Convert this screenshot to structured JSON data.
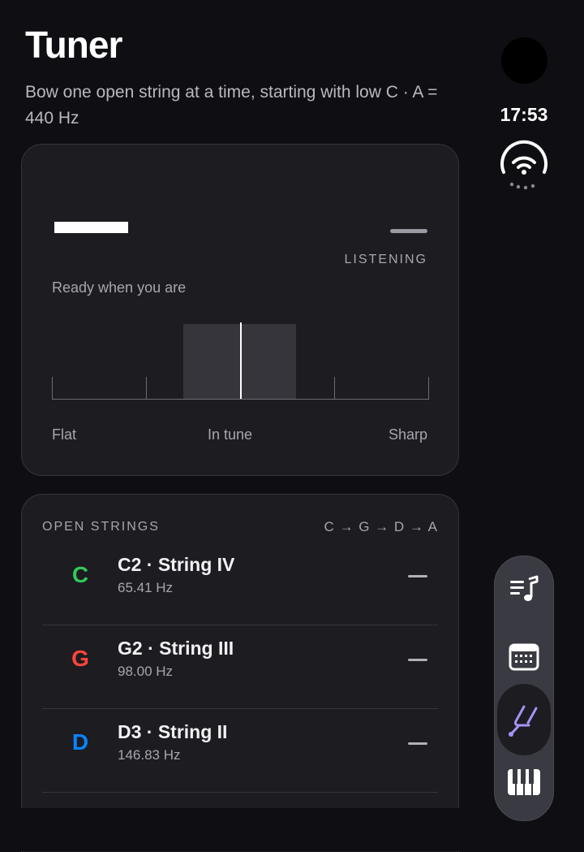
{
  "header": {
    "title": "Tuner",
    "subtitle": "Bow one open string at a time, starting with low C · A = 440 Hz"
  },
  "tuner": {
    "status": "LISTENING",
    "prompt": "Ready when you are",
    "scale_labels": {
      "flat": "Flat",
      "in_tune": "In tune",
      "sharp": "Sharp"
    }
  },
  "open_strings": {
    "heading": "OPEN STRINGS",
    "order": "C → G → D → A",
    "items": [
      {
        "letter": "C",
        "name": "C2 · String IV",
        "freq": "65.41 Hz",
        "color": "#34c759"
      },
      {
        "letter": "G",
        "name": "G2 · String III",
        "freq": "98.00 Hz",
        "color": "#ff453a"
      },
      {
        "letter": "D",
        "name": "D3 · String II",
        "freq": "146.83 Hz",
        "color": "#0a84ff"
      }
    ]
  },
  "status_bar": {
    "time": "17:53"
  },
  "colors": {
    "accent": "#a892f5",
    "background": "#0f0f13",
    "card": "#1c1c21"
  },
  "dock": {
    "items": [
      {
        "icon": "music-list-icon"
      },
      {
        "icon": "calendar-icon"
      },
      {
        "icon": "tuning-fork-icon",
        "active": true
      },
      {
        "icon": "piano-keys-icon"
      }
    ]
  }
}
